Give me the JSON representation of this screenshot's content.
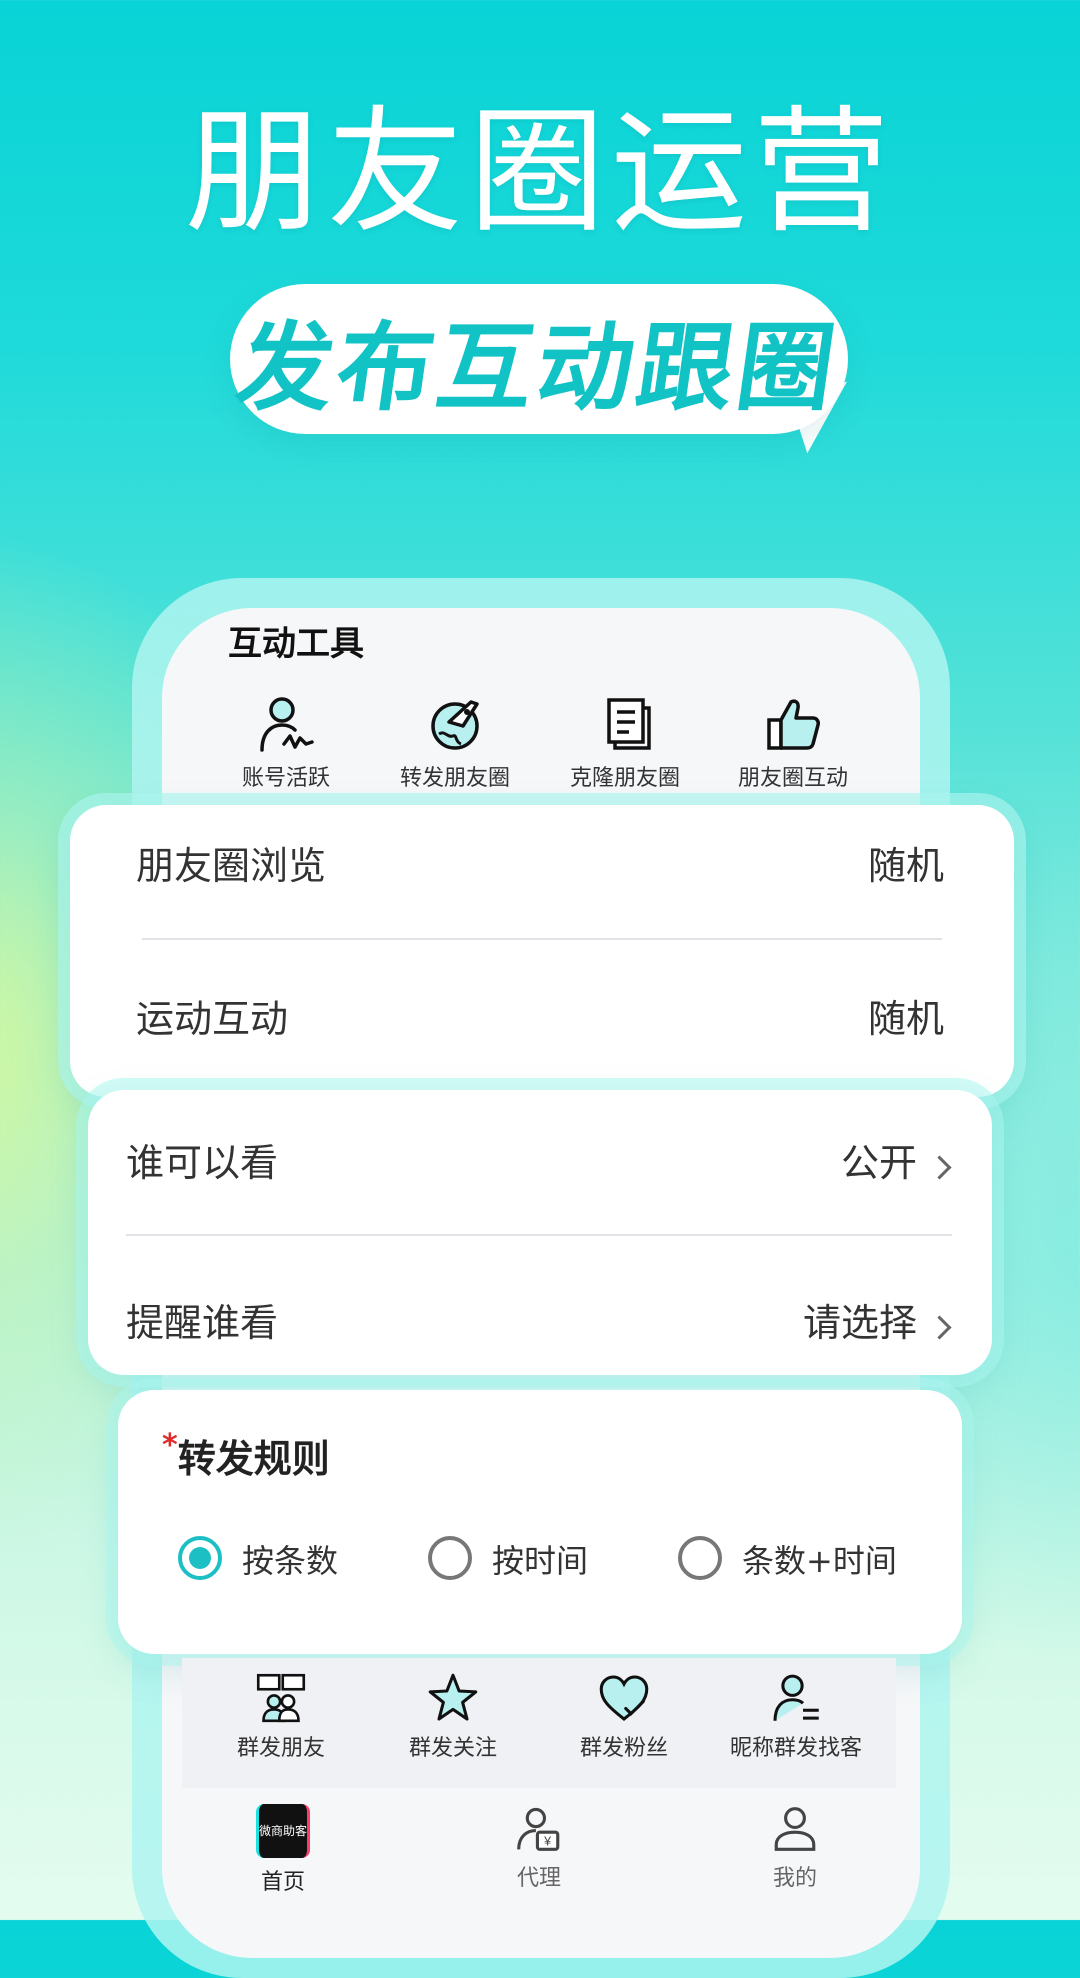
{
  "hero": {
    "title": "朋友圈运营",
    "bubble": "发布互动跟圈"
  },
  "tools": {
    "section_title": "互动工具",
    "items": [
      {
        "label": "账号活跃",
        "icon": "user-activity-icon"
      },
      {
        "label": "转发朋友圈",
        "icon": "globe-rocket-icon"
      },
      {
        "label": "克隆朋友圈",
        "icon": "document-clone-icon"
      },
      {
        "label": "朋友圈互动",
        "icon": "thumbs-up-icon"
      }
    ]
  },
  "card1": {
    "rows": [
      {
        "label": "朋友圈浏览",
        "value": "随机"
      },
      {
        "label": "运动互动",
        "value": "随机"
      }
    ]
  },
  "card2": {
    "rows": [
      {
        "label": "谁可以看",
        "value": "公开"
      },
      {
        "label": "提醒谁看",
        "value": "请选择"
      }
    ]
  },
  "card3": {
    "required_mark": "*",
    "title": "转发规则",
    "options": [
      {
        "label": "按条数",
        "selected": true
      },
      {
        "label": "按时间",
        "selected": false
      },
      {
        "label": "条数+时间",
        "selected": false
      }
    ]
  },
  "bottom_tools": {
    "items": [
      {
        "label": "群发朋友",
        "icon": "group-chat-icon"
      },
      {
        "label": "群发关注",
        "icon": "star-icon"
      },
      {
        "label": "群发粉丝",
        "icon": "heart-check-icon"
      },
      {
        "label": "昵称群发找客",
        "icon": "user-list-icon"
      }
    ]
  },
  "nav": {
    "items": [
      {
        "label": "首页",
        "icon": "app-logo-icon",
        "active": true,
        "logo_text": "微商助客"
      },
      {
        "label": "代理",
        "icon": "agent-icon",
        "active": false
      },
      {
        "label": "我的",
        "icon": "profile-icon",
        "active": false
      }
    ]
  },
  "colors": {
    "accent": "#1cc0c4",
    "required": "#e02b2b"
  }
}
